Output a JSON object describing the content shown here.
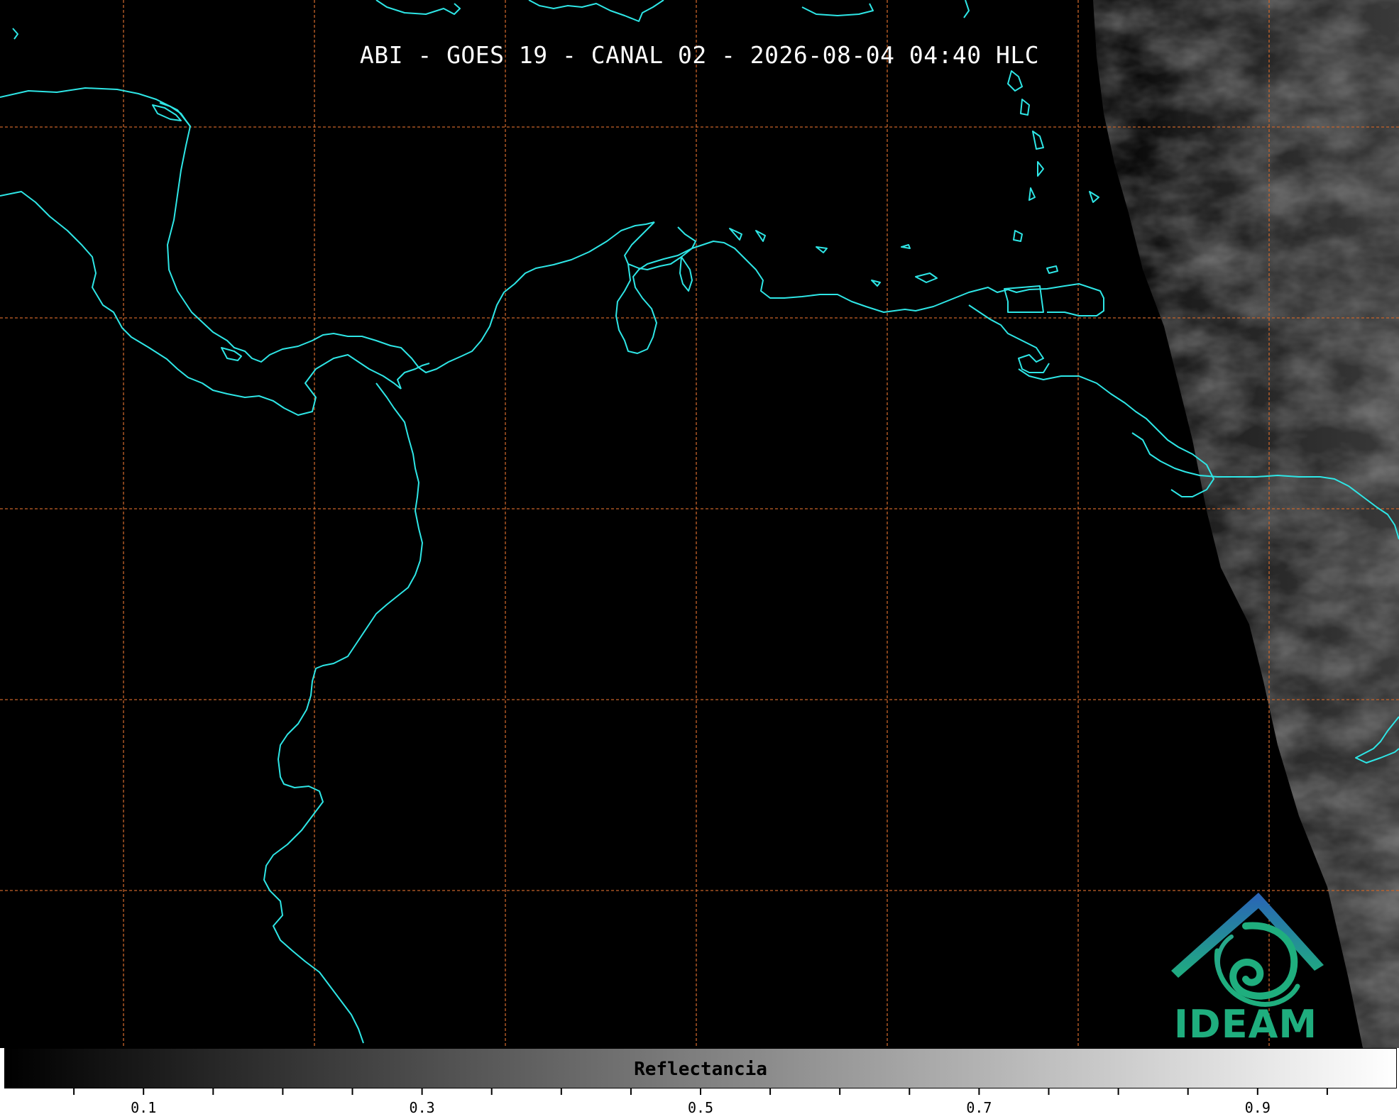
{
  "title": "ABI - GOES 19 - CANAL 02 - 2026-08-04 04:40 HLC",
  "colors": {
    "coastline": "#2ee6e6",
    "grid": "#c8642a",
    "background": "#000000",
    "logo_blue": "#2a63b8",
    "logo_green": "#1fae7e"
  },
  "colorbar": {
    "label": "Reflectancia",
    "range": [
      0,
      1
    ],
    "tick_labels": [
      "0.1",
      "0.3",
      "0.5",
      "0.7",
      "0.9"
    ],
    "colormap": "grayscale"
  },
  "logo": {
    "text": "IDEAM",
    "icon": "ideam-logo-icon"
  },
  "map": {
    "grid": true,
    "grid_style": "dashed"
  }
}
